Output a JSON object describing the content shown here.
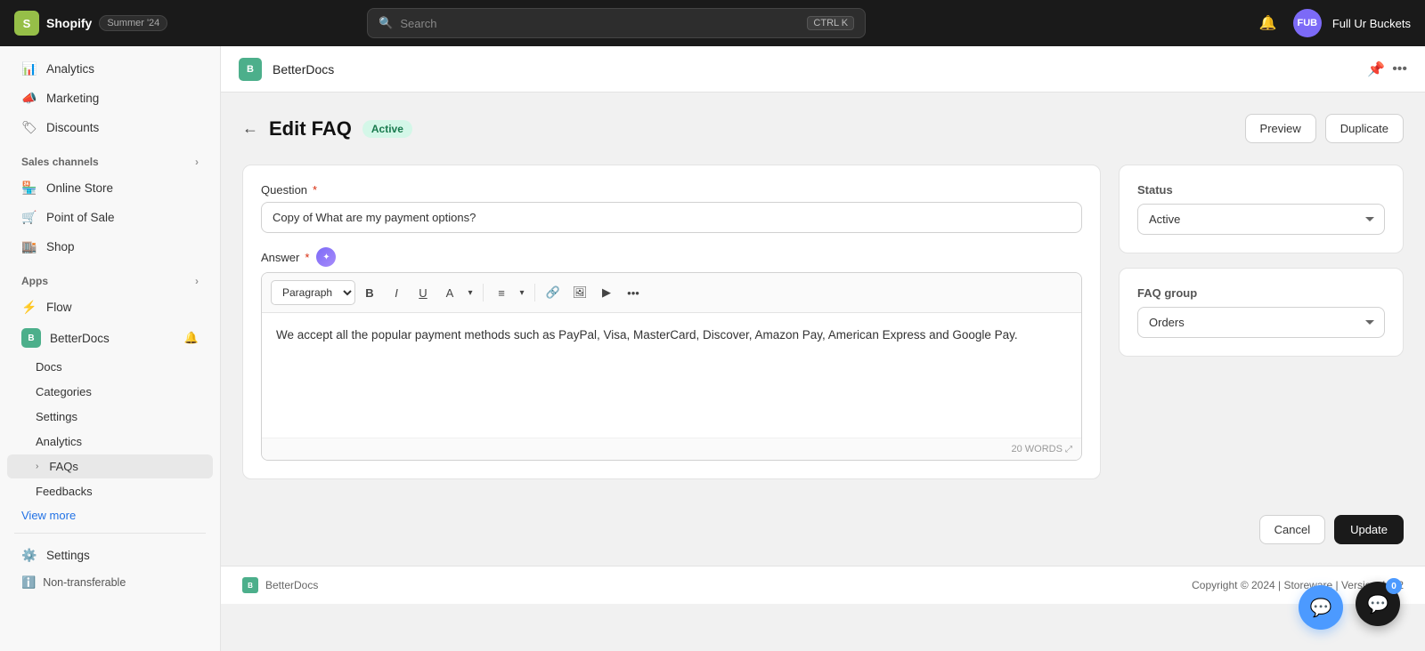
{
  "topbar": {
    "logo_text": "S",
    "app_name": "Shopify",
    "badge_label": "Summer '24",
    "search_placeholder": "Search",
    "search_shortcut": "CTRL K",
    "avatar_initials": "FUB",
    "store_name": "Full Ur Buckets"
  },
  "sidebar": {
    "analytics_label": "Analytics",
    "marketing_label": "Marketing",
    "discounts_label": "Discounts",
    "sales_channels_label": "Sales channels",
    "online_store_label": "Online Store",
    "point_of_sale_label": "Point of Sale",
    "shop_label": "Shop",
    "apps_label": "Apps",
    "flow_label": "Flow",
    "betterdocs_label": "BetterDocs",
    "docs_label": "Docs",
    "categories_label": "Categories",
    "settings_label": "Settings",
    "analytics_sub_label": "Analytics",
    "faqs_label": "FAQs",
    "feedbacks_label": "Feedbacks",
    "view_more_label": "View more",
    "settings_main_label": "Settings",
    "non_transferable_label": "Non-transferable"
  },
  "app_header": {
    "title": "BetterDocs",
    "icon_text": "B"
  },
  "page": {
    "back_icon": "←",
    "title": "Edit FAQ",
    "active_badge": "Active",
    "preview_label": "Preview",
    "duplicate_label": "Duplicate"
  },
  "form": {
    "question_label": "Question",
    "question_required": "*",
    "question_value": "Copy of What are my payment options?",
    "answer_label": "Answer",
    "answer_required": "*",
    "paragraph_option": "Paragraph",
    "answer_content": "We accept all the popular payment methods such as PayPal, Visa, MasterCard, Discover, Amazon Pay, American Express and Google Pay.",
    "word_count": "20 WORDS",
    "status_label": "Status",
    "status_value": "Active",
    "faq_group_label": "FAQ group",
    "faq_group_value": "Orders",
    "cancel_label": "Cancel",
    "update_label": "Update"
  },
  "footer": {
    "app_name": "BetterDocs",
    "copyright": "Copyright © 2024 | Storeware | Version 4.2.2",
    "icon_text": "B"
  },
  "toolbar_buttons": [
    {
      "label": "B",
      "name": "bold-btn"
    },
    {
      "label": "I",
      "name": "italic-btn"
    },
    {
      "label": "U",
      "name": "underline-btn"
    },
    {
      "label": "A",
      "name": "text-color-btn"
    },
    {
      "label": "≡",
      "name": "align-btn"
    },
    {
      "label": "🔗",
      "name": "link-btn"
    },
    {
      "label": "🖼",
      "name": "image-btn"
    },
    {
      "label": "▶",
      "name": "video-btn"
    },
    {
      "label": "•••",
      "name": "more-btn"
    }
  ]
}
